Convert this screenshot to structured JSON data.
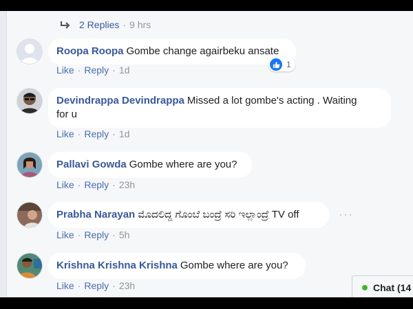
{
  "replies_header": {
    "label": "2 Replies",
    "time": "9 hrs"
  },
  "comments": [
    {
      "author": "Roopa Roopa",
      "text": "Gombe change agairbeku ansate",
      "like": "Like",
      "reply": "Reply",
      "time": "1d",
      "reaction_count": "1",
      "avatar": "default-avatar"
    },
    {
      "author": "Devindrappa Devindrappa",
      "text": "Missed a lot gombe's acting . Waiting",
      "text2": "for u",
      "like": "Like",
      "reply": "Reply",
      "time": "1d",
      "avatar": "man-sunglasses-photo"
    },
    {
      "author": "Pallavi Gowda",
      "text": "Gombe where are you?",
      "like": "Like",
      "reply": "Reply",
      "time": "23h",
      "avatar": "woman-photo"
    },
    {
      "author": "Prabha Narayan",
      "text": "ಮೊದಲಿದ್ದ ಗೊಂಬೆ ಬಂದ್ರೆ ಸರಿ ಇಲ್ಲಾಂದ್ರೆ TV off",
      "like": "Like",
      "reply": "Reply",
      "time": "5h",
      "avatar": "person-photo"
    },
    {
      "author": "Krishna Krishna Krishna",
      "text": "Gombe where are you?",
      "like": "Like",
      "reply": "Reply",
      "time": "23h",
      "avatar": "man-photo"
    }
  ],
  "chat": {
    "label": "Chat (14"
  },
  "colors": {
    "author": "#385898",
    "like_blue": "#1877f2",
    "online": "#42b72a"
  }
}
